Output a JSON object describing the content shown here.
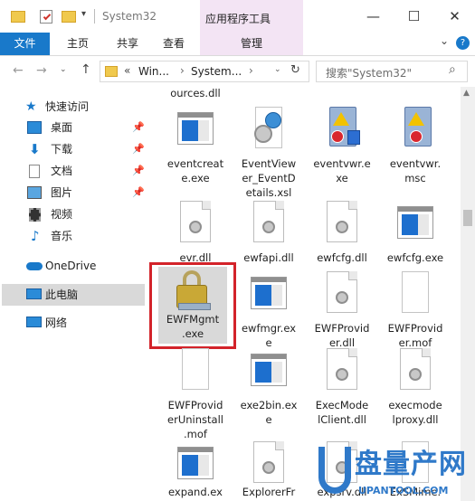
{
  "window": {
    "title": "System32",
    "context_group": "应用程序工具",
    "buttons": {
      "minimize": "—",
      "maximize": "☐",
      "close": "✕"
    }
  },
  "ribbon": {
    "tabs": [
      "文件",
      "主页",
      "共享",
      "查看",
      "管理"
    ],
    "collapse": "⌄",
    "help": "?"
  },
  "address": {
    "crumbs": [
      "«",
      "Win...",
      "›",
      "System...",
      "›"
    ],
    "search_placeholder": "搜索\"System32\""
  },
  "nav": {
    "quick_access": "快速访问",
    "items": [
      "桌面",
      "下载",
      "文档",
      "图片",
      "视频",
      "音乐"
    ],
    "onedrive": "OneDrive",
    "this_pc": "此电脑",
    "network": "网络"
  },
  "files": {
    "top_partial": "ources.dll",
    "row1": [
      "eventcreat\ne.exe",
      "EventView\ner_EventD\netails.xsl",
      "eventvwr.e\nxe",
      "eventvwr.\nmsc"
    ],
    "row2": [
      "evr.dll",
      "ewfapi.dll",
      "ewfcfg.dll",
      "ewfcfg.exe"
    ],
    "row3": [
      "EWFMgmt\n.exe",
      "ewfmgr.ex\ne",
      "EWFProvid\ner.dll",
      "EWFProvid\ner.mof"
    ],
    "row4": [
      "EWFProvid\nerUninstall\n.mof",
      "exe2bin.ex\ne",
      "ExecMode\nlClient.dll",
      "execmode\nlproxy.dll"
    ],
    "row5": [
      "expand.ex",
      "ExplorerFr",
      "expsrv.dll",
      "ExSMime."
    ]
  },
  "watermark": {
    "text": "盘量产网",
    "url": "UPANTOOL.COM"
  },
  "colors": {
    "accent": "#1979ca",
    "manage_tab": "#f3e4f4",
    "highlight_box": "#d3232a",
    "selection": "#cce8ff"
  }
}
